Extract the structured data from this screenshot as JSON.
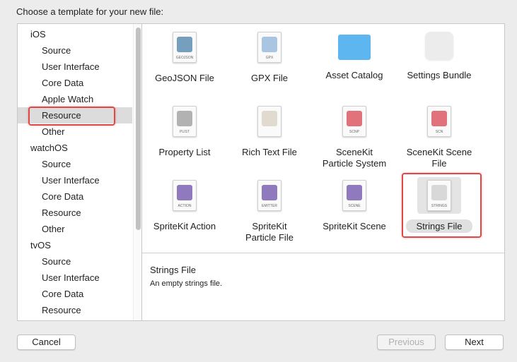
{
  "title": "Choose a template for your new file:",
  "sidebar": [
    {
      "label": "iOS",
      "type": "grp"
    },
    {
      "label": "Source",
      "type": "sub"
    },
    {
      "label": "User Interface",
      "type": "sub"
    },
    {
      "label": "Core Data",
      "type": "sub"
    },
    {
      "label": "Apple Watch",
      "type": "sub"
    },
    {
      "label": "Resource",
      "type": "sub",
      "selected": true
    },
    {
      "label": "Other",
      "type": "sub"
    },
    {
      "label": "watchOS",
      "type": "grp"
    },
    {
      "label": "Source",
      "type": "sub"
    },
    {
      "label": "User Interface",
      "type": "sub"
    },
    {
      "label": "Core Data",
      "type": "sub"
    },
    {
      "label": "Resource",
      "type": "sub"
    },
    {
      "label": "Other",
      "type": "sub"
    },
    {
      "label": "tvOS",
      "type": "grp"
    },
    {
      "label": "Source",
      "type": "sub"
    },
    {
      "label": "User Interface",
      "type": "sub"
    },
    {
      "label": "Core Data",
      "type": "sub"
    },
    {
      "label": "Resource",
      "type": "sub"
    }
  ],
  "templates": [
    {
      "label": "GeoJSON File",
      "tag": "GEOJSON",
      "icon": "geojson-file-icon",
      "color": "#4a7fa8"
    },
    {
      "label": "GPX File",
      "tag": "GPX",
      "icon": "gpx-file-icon",
      "color": "#8fb3d9"
    },
    {
      "label": "Asset Catalog",
      "tag": "",
      "icon": "folder-icon",
      "color": "#5db6ef"
    },
    {
      "label": "Settings Bundle",
      "tag": "",
      "icon": "settings-bundle-icon",
      "color": "#ececec"
    },
    {
      "label": "Property List",
      "tag": "PLIST",
      "icon": "plist-file-icon",
      "color": "#999999"
    },
    {
      "label": "Rich Text File",
      "tag": "",
      "icon": "rtf-file-icon",
      "color": "#d8d0c0"
    },
    {
      "label": "SceneKit\nParticle System",
      "tag": "SCNP",
      "icon": "scenekit-particle-icon",
      "color": "#d8434f"
    },
    {
      "label": "SceneKit Scene\nFile",
      "tag": "SCN",
      "icon": "scenekit-scene-icon",
      "color": "#d8434f"
    },
    {
      "label": "SpriteKit Action",
      "tag": "ACTION",
      "icon": "spritekit-action-icon",
      "color": "#6a4fa8"
    },
    {
      "label": "SpriteKit\nParticle File",
      "tag": "EMITTER",
      "icon": "spritekit-emitter-icon",
      "color": "#6a4fa8"
    },
    {
      "label": "SpriteKit Scene",
      "tag": "SCENE",
      "icon": "spritekit-scene-icon",
      "color": "#6a4fa8"
    },
    {
      "label": "Strings File",
      "tag": "STRINGS",
      "icon": "strings-file-icon",
      "color": "#cccccc",
      "selected": true
    }
  ],
  "description": {
    "title": "Strings File",
    "text": "An empty strings file."
  },
  "buttons": {
    "cancel": "Cancel",
    "previous": "Previous",
    "next": "Next"
  }
}
